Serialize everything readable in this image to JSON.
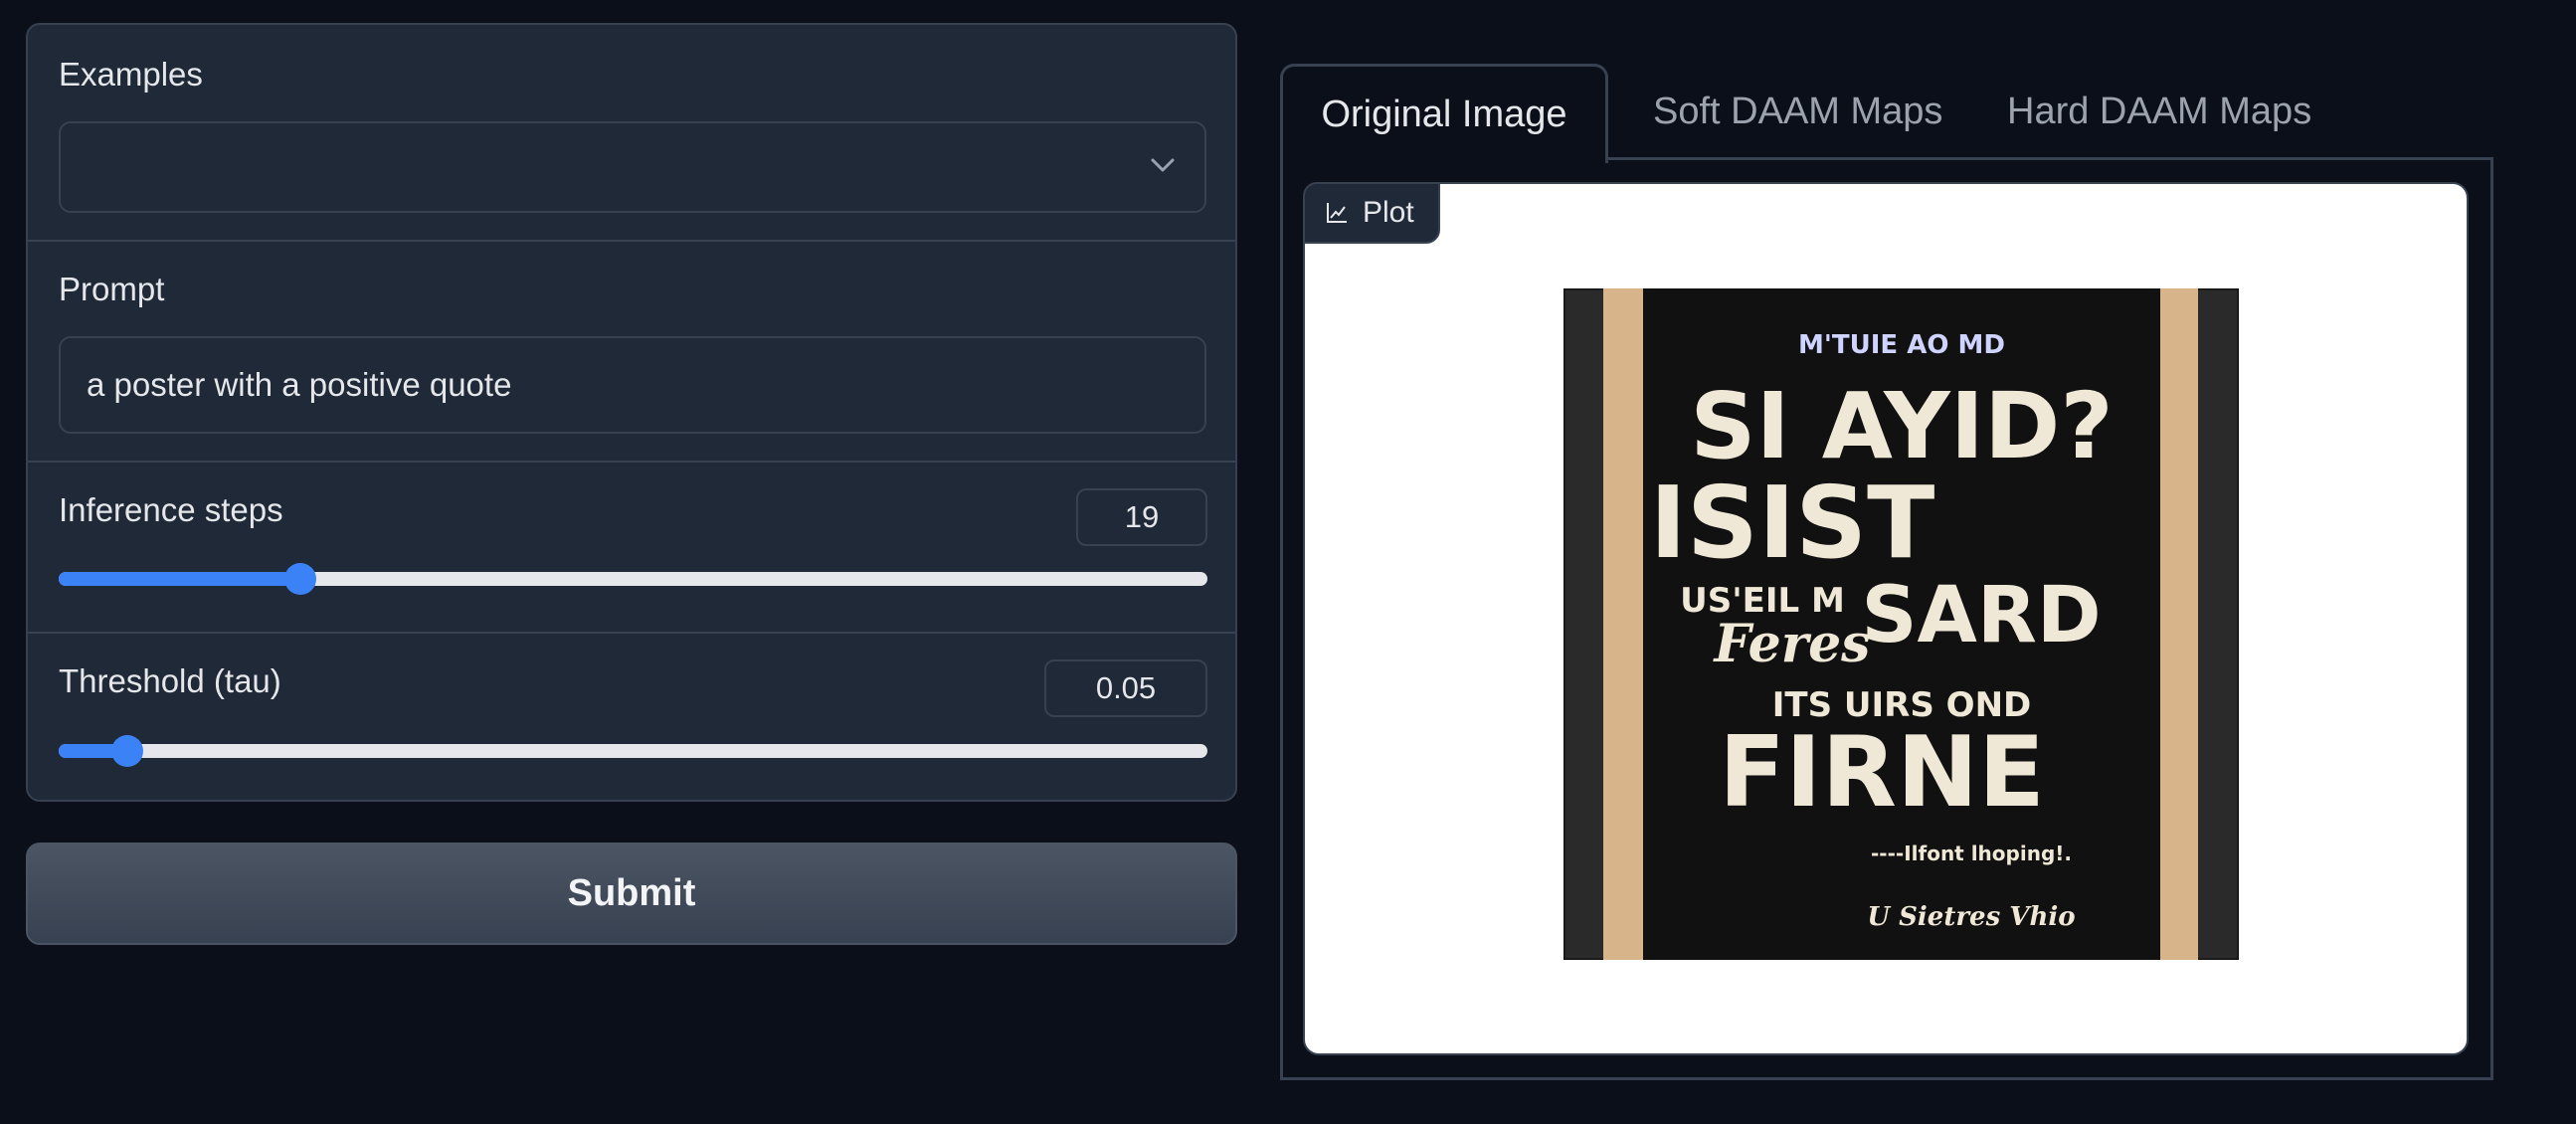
{
  "examples": {
    "label": "Examples",
    "value": ""
  },
  "prompt": {
    "label": "Prompt",
    "value": "a poster with a positive quote"
  },
  "inference_steps": {
    "label": "Inference steps",
    "value": "19",
    "fraction": 0.21
  },
  "threshold": {
    "label": "Threshold (tau)",
    "value": "0.05",
    "fraction": 0.06
  },
  "submit": {
    "label": "Submit"
  },
  "tabs": [
    {
      "label": "Original Image",
      "active": true
    },
    {
      "label": "Soft DAAM Maps",
      "active": false
    },
    {
      "label": "Hard DAAM Maps",
      "active": false
    }
  ],
  "plot": {
    "chip_label": "Plot",
    "icon": "chart-icon"
  },
  "poster": {
    "lines": [
      "M'TUIE AO MD",
      "SI AYID?",
      "ISIST",
      "US'EIL M",
      "SARD",
      "Feres",
      "ITS UIRS OND",
      "FIRNE",
      "----Ilfont lhoping!.",
      "U Sietres Vhio"
    ]
  },
  "colors": {
    "accent": "#3b82f6",
    "background": "#0b0f19",
    "panel": "#1f2937",
    "border": "#374151"
  }
}
